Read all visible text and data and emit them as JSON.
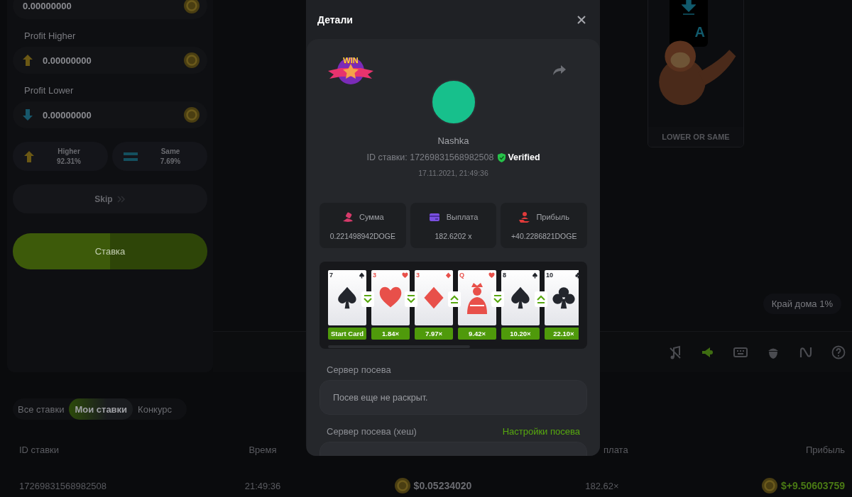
{
  "bet_panel": {
    "amount_field": {
      "value": "0.00000000"
    },
    "profit_fields": [
      {
        "kind": "higher",
        "label": "Profit Higher",
        "value": "0.00000000"
      },
      {
        "kind": "lower",
        "label": "Profit Lower",
        "value": "0.00000000"
      }
    ],
    "choices": [
      {
        "kind": "higher",
        "label": "Higher",
        "chance": "92.31%"
      },
      {
        "kind": "same",
        "label": "Same",
        "chance": "7.69%"
      }
    ],
    "skip_button": "Skip",
    "bet_button": "Ставка"
  },
  "game": {
    "choice_card": {
      "letter": "A",
      "label": "LOWER OR SAME"
    },
    "house_edge": "Край дома 1%",
    "toolbar": [
      {
        "kind": "music-off",
        "active": false
      },
      {
        "kind": "speaker",
        "active": true
      },
      {
        "kind": "keyboard",
        "active": false
      },
      {
        "kind": "acorn",
        "active": false
      },
      {
        "kind": "curve",
        "active": false
      },
      {
        "kind": "help",
        "active": false
      }
    ]
  },
  "bets": {
    "tabs": [
      {
        "label": "Все ставки",
        "selected": false
      },
      {
        "label": "Мои ставки",
        "selected": true
      },
      {
        "label": "Конкурс",
        "selected": false
      }
    ],
    "columns": [
      {
        "kind": "id",
        "label": "ID ставки"
      },
      {
        "kind": "time",
        "label": "Время"
      },
      {
        "kind": "payout",
        "label": "плата"
      },
      {
        "kind": "profit",
        "label": "Прибыль"
      }
    ],
    "rows": [
      {
        "id": "17269831568982508",
        "time": "21:49:36",
        "amount": "$0.05234020",
        "payout": "182.62×",
        "profit": "$+9.50603759",
        "win": true
      }
    ]
  },
  "details_modal": {
    "title": "Детали",
    "badge": "WIN",
    "player": "Nashka",
    "bet_id": "ID ставки: 17269831568982508",
    "verified": "Verified",
    "date": "17.11.2021, 21:49:36",
    "stats": [
      {
        "kind": "amount",
        "label": "Сумма",
        "value": "0.221498942DOGE"
      },
      {
        "kind": "payout",
        "label": "Выплата",
        "value": "182.6202 x"
      },
      {
        "kind": "profit",
        "label": "Прибыль",
        "value": "+40.2286821DOGE"
      }
    ],
    "cards": [
      {
        "rank": "7",
        "kind": "spades",
        "face": false,
        "label": "Start Card",
        "higher": false
      },
      {
        "rank": "3",
        "kind": "hearts",
        "face": false,
        "label": "1.84×",
        "higher": false
      },
      {
        "rank": "3",
        "kind": "diamonds",
        "face": false,
        "label": "7.97×",
        "higher": true
      },
      {
        "rank": "Q",
        "kind": "hearts",
        "face": true,
        "label": "9.42×",
        "higher": false
      },
      {
        "rank": "8",
        "kind": "spades",
        "face": false,
        "label": "10.20×",
        "higher": true
      },
      {
        "rank": "10",
        "kind": "clubs",
        "face": false,
        "label": "22.10×"
      }
    ],
    "fields": [
      {
        "label": "Сервер посева",
        "value": "Посев еще не раскрыт."
      },
      {
        "label": "Сервер посева (хеш)",
        "link": "Настройки посева"
      }
    ]
  }
}
